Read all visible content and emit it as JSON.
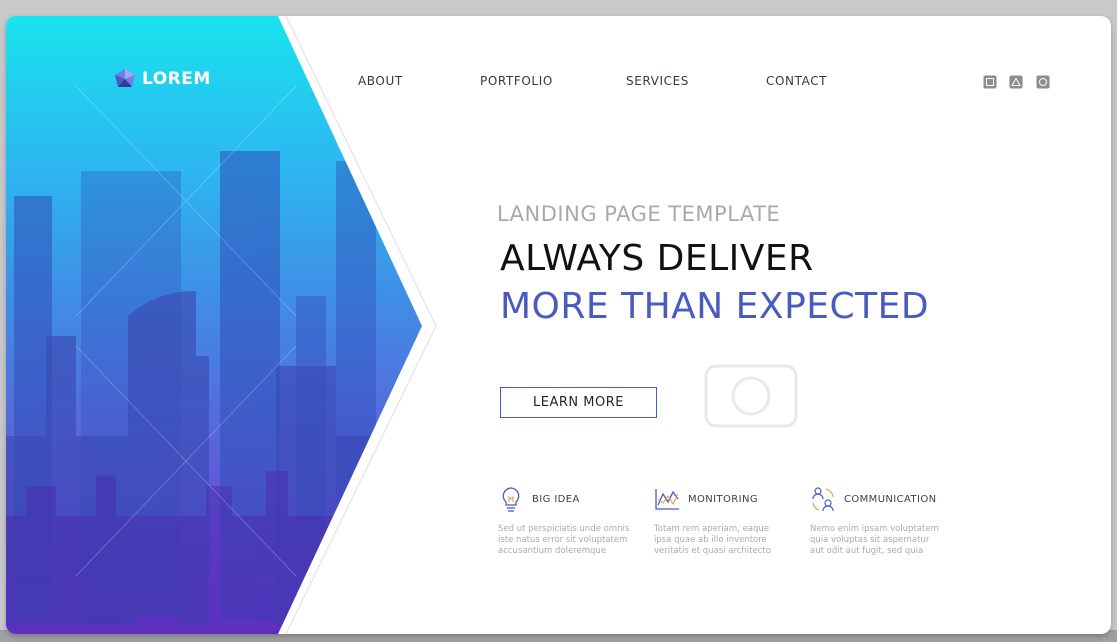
{
  "logo": {
    "text": "LOREM",
    "icon": "polygon-logo-icon"
  },
  "nav": {
    "items": [
      "ABOUT",
      "PORTFOLIO",
      "SERVICES",
      "CONTACT"
    ]
  },
  "social": {
    "icons": [
      "square-social-icon",
      "triangle-social-icon",
      "circle-social-icon"
    ]
  },
  "hero": {
    "subtitle": "LANDING PAGE TEMPLATE",
    "headline_line1": "ALWAYS DELIVER",
    "headline_line2": "MORE THAN EXPECTED",
    "cta_label": "LEARN MORE"
  },
  "features": [
    {
      "icon": "lightbulb-icon",
      "title": "BIG IDEA",
      "desc": [
        "Sed ut perspiciatis unde omnis",
        "iste natus error sit voluptatem",
        "accusantium doleremque"
      ]
    },
    {
      "icon": "chart-monitoring-icon",
      "title": "MONITORING",
      "desc": [
        "Totam rem aperiam, eaque",
        "ipsa quae ab illo inventore",
        "veritatis et quasi architecto"
      ]
    },
    {
      "icon": "people-cycle-icon",
      "title": "COMMUNICATION",
      "desc": [
        "Nemo enim ipsam voluptatem",
        "quia voluptas sit aspernatur",
        "aut odit aut fugit, sed quia"
      ]
    }
  ],
  "colors": {
    "accent": "#4a5bbf",
    "gradient_top": "#19e3ee",
    "gradient_bottom": "#7b2fd6",
    "headline": "#111111",
    "subtitle": "#a6a9ae"
  }
}
